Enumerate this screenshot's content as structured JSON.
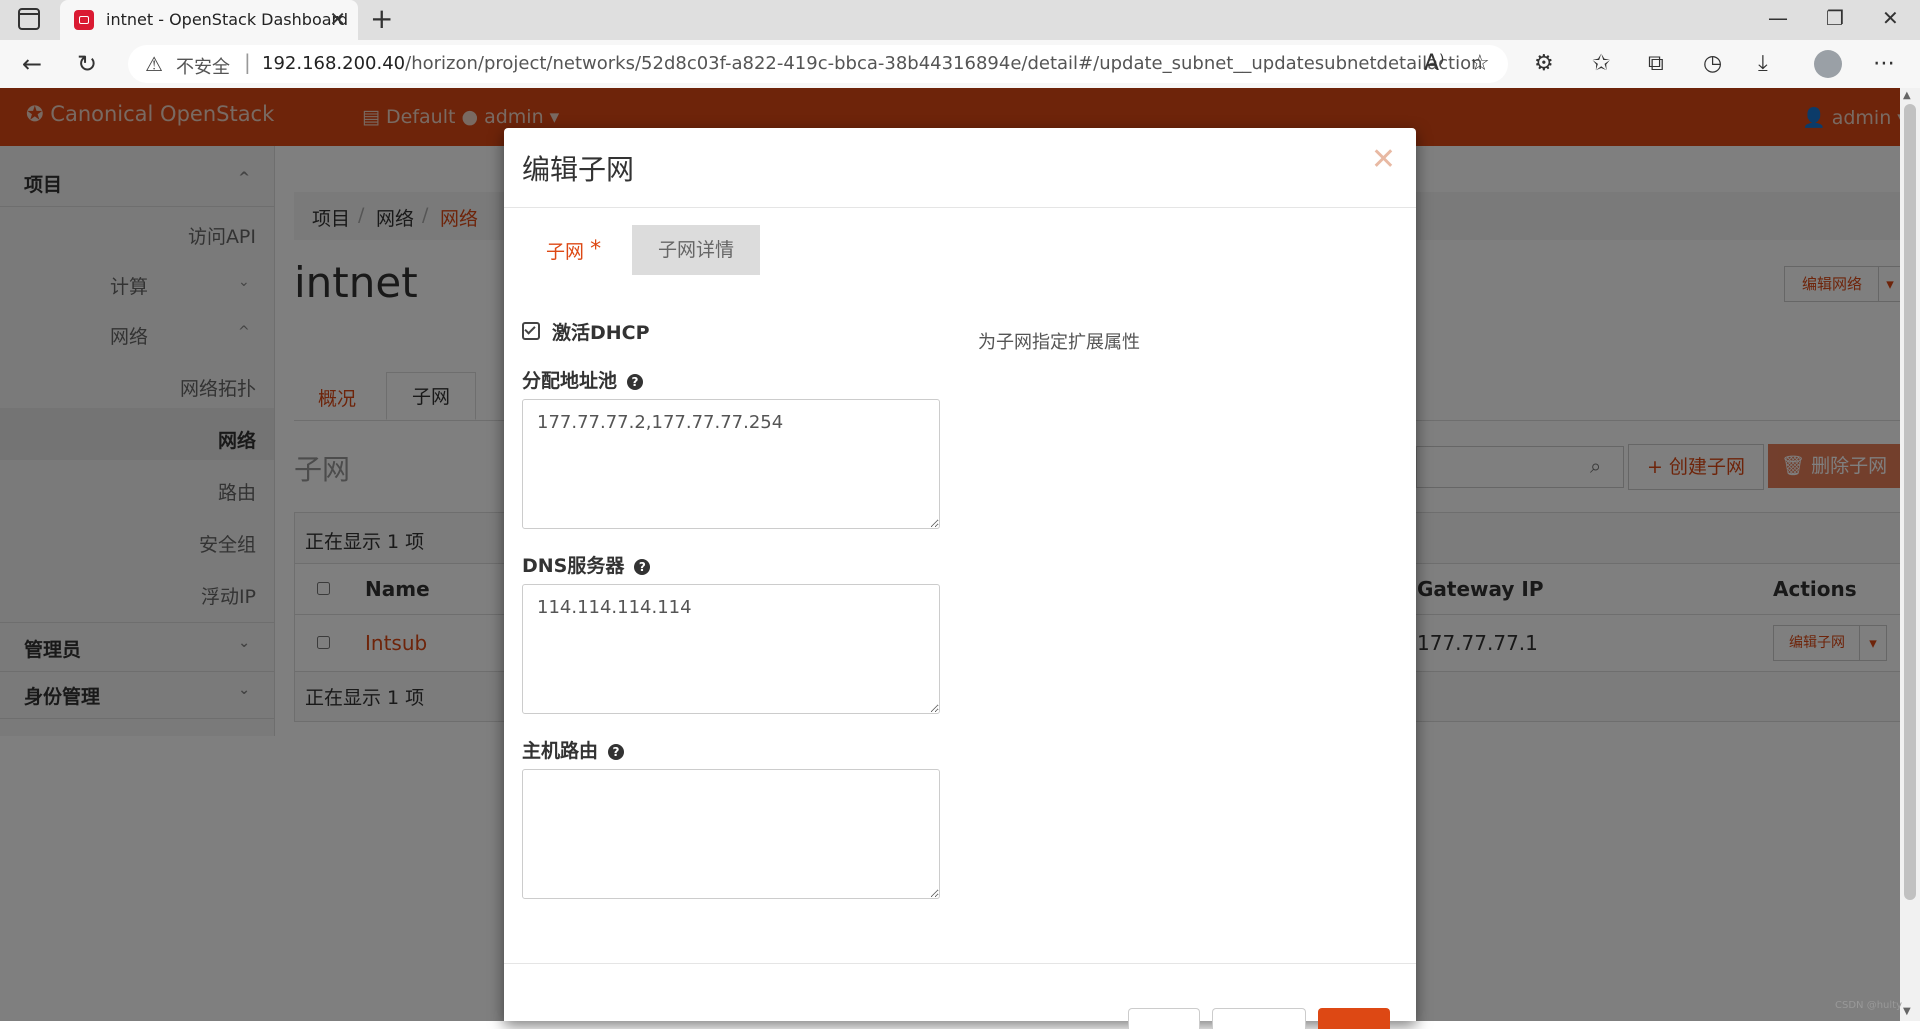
{
  "browser": {
    "tab_title": "intnet - OpenStack Dashboard",
    "insecure_label": "不安全",
    "url_host": "192.168.200.40",
    "url_path": "/horizon/project/networks/52d8c03f-a822-419c-bbca-38b44316894e/detail#/update_subnet__updatesubnetdetailaction"
  },
  "header": {
    "brand": "Canonical OpenStack",
    "project_selector": "Default ● admin ▾",
    "user_menu": "admin ▾"
  },
  "sidebar": {
    "project": "项目",
    "api_access": "访问API",
    "compute": "计算",
    "network": "网络",
    "topology": "网络拓扑",
    "networks": "网络",
    "routers": "路由",
    "security_groups": "安全组",
    "floating_ips": "浮动IP",
    "admin": "管理员",
    "identity": "身份管理"
  },
  "breadcrumb": {
    "a": "项目",
    "b": "网络",
    "c": "网络"
  },
  "page": {
    "title": "intnet",
    "edit_network": "编辑网络",
    "tab_overview": "概况",
    "tab_subnets": "子网",
    "section_title": "子网",
    "create_subnet": "+ 创建子网",
    "delete_subnets": "删除子网",
    "showing": "正在显示 1 项",
    "showing_footer": "正在显示 1 项",
    "col_name": "Name",
    "col_gateway": "Gateway IP",
    "col_actions": "Actions",
    "row_name": "Intsub",
    "row_gateway": "177.77.77.1",
    "row_action": "编辑子网"
  },
  "modal": {
    "title": "编辑子网",
    "tab_subnet": "子网",
    "tab_subnet_required": "*",
    "tab_details": "子网详情",
    "enable_dhcp": "激活DHCP",
    "allocation_pools_label": "分配地址池",
    "allocation_pools_value": "177.77.77.2,177.77.77.254",
    "dns_label": "DNS服务器",
    "dns_value": "114.114.114.114",
    "host_routes_label": "主机路由",
    "host_routes_value": "",
    "help_text": "为子网指定扩展属性"
  },
  "watermark": "CSDN @hulty",
  "colors": {
    "accent": "#dd4814"
  }
}
